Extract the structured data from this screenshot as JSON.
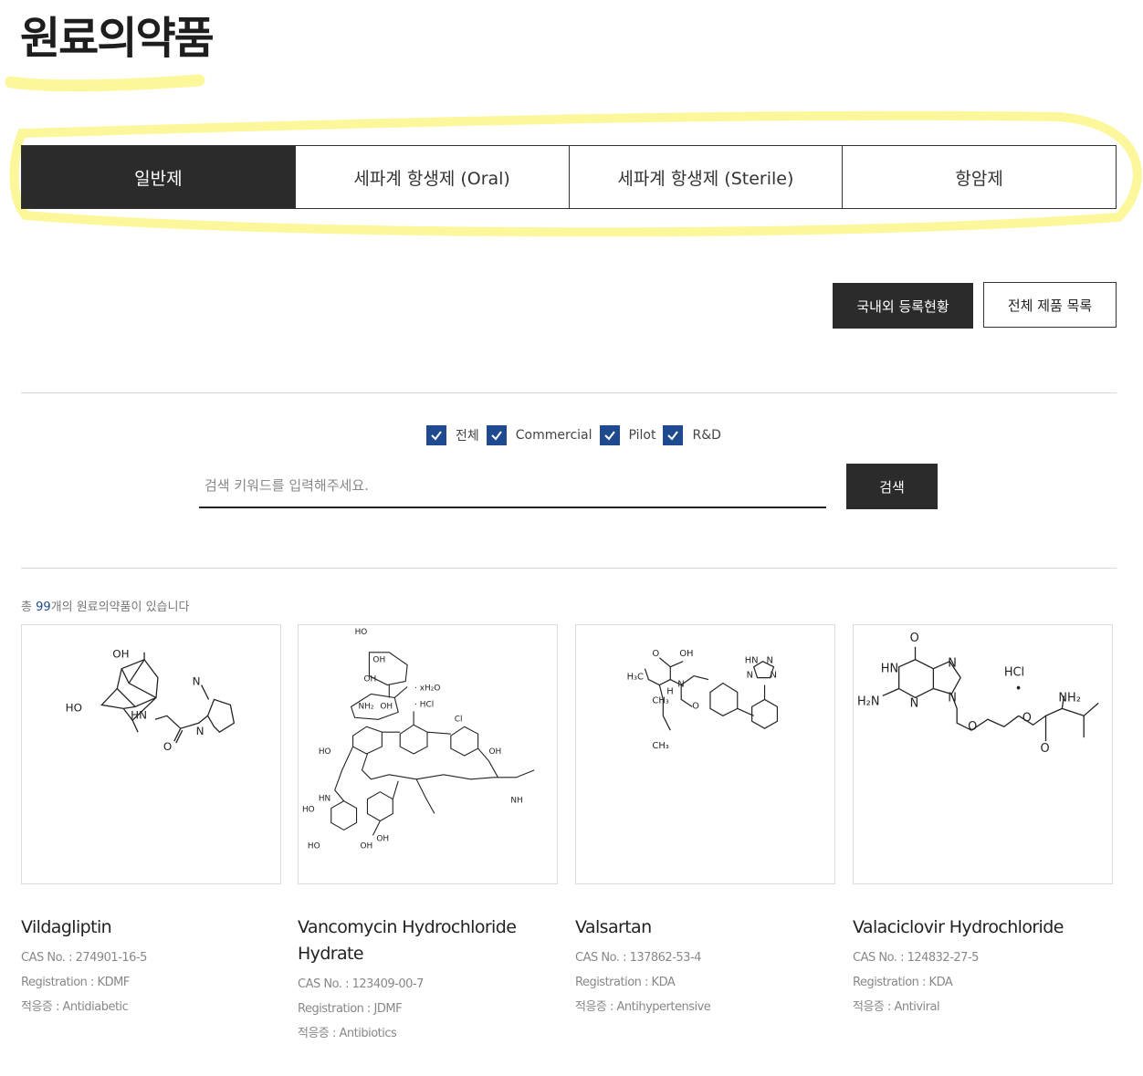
{
  "page": {
    "title": "원료의약품"
  },
  "tabs": [
    {
      "label": "일반제",
      "active": true
    },
    {
      "label": "세파계 항생제 (Oral)",
      "active": false
    },
    {
      "label": "세파계 항생제 (Sterile)",
      "active": false
    },
    {
      "label": "항암제",
      "active": false
    }
  ],
  "actions": {
    "registration_label": "국내외 등록현황",
    "full_list_label": "전체 제품 목록"
  },
  "filters": [
    {
      "label": "전체",
      "checked": true
    },
    {
      "label": "Commercial",
      "checked": true
    },
    {
      "label": "Pilot",
      "checked": true
    },
    {
      "label": "R&D",
      "checked": true
    }
  ],
  "search": {
    "placeholder": "검색 키워드를 입력해주세요.",
    "value": "",
    "button_label": "검색"
  },
  "result": {
    "prefix": "총 ",
    "count": "99",
    "suffix": "개의 원료의약품이 있습니다"
  },
  "products": [
    {
      "name": "Vildagliptin",
      "cas": "CAS No. : 274901-16-5",
      "registration": "Registration : KDMF",
      "indication": "적응증 : Antidiabetic",
      "formula_labels": {
        "oh": "OH",
        "ho": "HO",
        "hn": "HN",
        "n1": "N",
        "n2": "N",
        "o": "O"
      }
    },
    {
      "name": "Vancomycin Hydrochloride Hydrate",
      "cas": "CAS No. : 123409-00-7",
      "registration": "Registration : JDMF",
      "indication": "적응증 : Antibiotics",
      "formula_labels": {
        "ho_top": "HO",
        "oh1": "OH",
        "oh2": "OH",
        "nh2": "NH₂",
        "oh3": "OH",
        "water": "· xH₂O",
        "hcl": "· HCl",
        "cl": "Cl",
        "ho_left": "HO",
        "oh_right": "OH",
        "hn": "HN",
        "nh": "NH",
        "ho2": "HO",
        "ho3": "HO",
        "oh4": "OH",
        "oh5": "OH"
      }
    },
    {
      "name": "Valsartan",
      "cas": "CAS No. : 137862-53-4",
      "registration": "Registration : KDA",
      "indication": "적응증 : Antihypertensive",
      "formula_labels": {
        "o": "O",
        "oh": "OH",
        "h3c": "H₃C",
        "ch3a": "CH₃",
        "h": "H",
        "n": "N",
        "o2": "O",
        "ch3b": "CH₃",
        "hn": "HN",
        "nn": "N",
        "n3": "N",
        "n4": "N"
      }
    },
    {
      "name": "Valaciclovir Hydrochloride",
      "cas": "CAS No. : 124832-27-5",
      "registration": "Registration : KDA",
      "indication": "적응증 : Antiviral",
      "formula_labels": {
        "o_top": "O",
        "hn": "HN",
        "n1": "N",
        "n2": "N",
        "n3": "N",
        "h2n": "H₂N",
        "hcl": "HCl",
        "dot": "•",
        "nh2": "NH₂",
        "o1": "O",
        "o2": "O",
        "o3": "O"
      }
    }
  ]
}
